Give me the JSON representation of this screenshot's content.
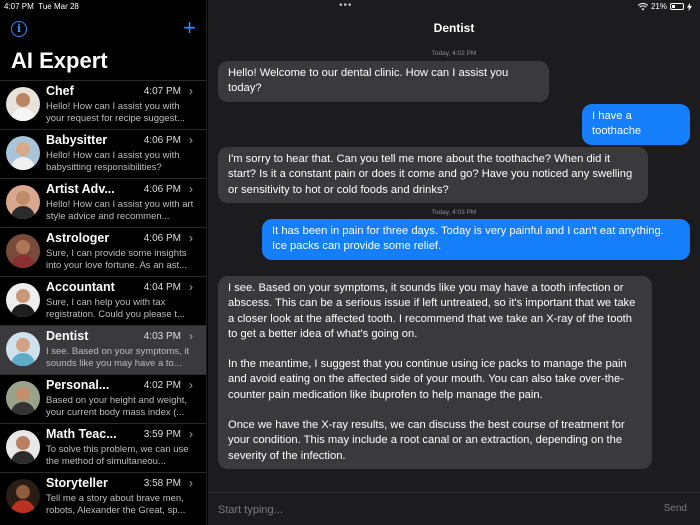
{
  "status_bar": {
    "time": "4:07 PM",
    "date": "Tue Mar 28",
    "battery_text": "21%",
    "battery_level": 21,
    "wifi_icon": "wifi-icon",
    "charging_icon": "bolt-icon"
  },
  "sidebar": {
    "title": "AI Expert",
    "info_icon": "info-icon",
    "add_icon": "plus-icon",
    "items": [
      {
        "name": "Chef",
        "time": "4:07 PM",
        "preview": "Hello! How can I assist you with your request for recipe suggest..."
      },
      {
        "name": "Babysitter",
        "time": "4:06 PM",
        "preview": "Hello! How can I assist you with babysitting responsibilities?"
      },
      {
        "name": "Artist Adv...",
        "time": "4:06 PM",
        "preview": "Hello! How can I assist you with art style advice and recommen..."
      },
      {
        "name": "Astrologer",
        "time": "4:06 PM",
        "preview": "Sure, I can provide some insights into your love fortune. As an ast..."
      },
      {
        "name": "Accountant",
        "time": "4:04 PM",
        "preview": "Sure, I can help you with tax registration. Could you please t..."
      },
      {
        "name": "Dentist",
        "time": "4:03 PM",
        "preview": "I see. Based on your symptoms, it sounds like you may have a to..."
      },
      {
        "name": "Personal...",
        "time": "4:02 PM",
        "preview": "Based on your height and weight, your current body mass index (..."
      },
      {
        "name": "Math Teac...",
        "time": "3:59 PM",
        "preview": "To solve this problem, we can use the method of simultaneou..."
      },
      {
        "name": "Storyteller",
        "time": "3:58 PM",
        "preview": "Tell me a story about brave men, robots, Alexander the Great, sp..."
      }
    ]
  },
  "chat": {
    "title": "Dentist",
    "timestamps": [
      "Today, 4:02 PM",
      "Today, 4:03 PM"
    ],
    "messages": [
      {
        "role": "ai",
        "paragraphs": [
          "Hello! Welcome to our dental clinic. How can I assist you today?"
        ]
      },
      {
        "role": "user",
        "paragraphs": [
          "I have a toothache"
        ]
      },
      {
        "role": "ai",
        "paragraphs": [
          "I'm sorry to hear that. Can you tell me more about the toothache? When did it start? Is it a constant pain or does it come and go? Have you noticed any swelling or sensitivity to hot or cold foods and drinks?"
        ]
      },
      {
        "role": "user",
        "paragraphs": [
          "It has been in pain for three days. Today is very painful and I can't eat anything. Ice packs can provide some relief."
        ]
      },
      {
        "role": "ai",
        "paragraphs": [
          "I see. Based on your symptoms, it sounds like you may have a tooth infection or abscess. This can be a serious issue if left untreated, so it's important that we take a closer look at the affected tooth. I recommend that we take an X-ray of the tooth to get a better idea of what's going on.",
          "In the meantime, I suggest that you continue using ice packs to manage the pain and avoid eating on the affected side of your mouth. You can also take over-the-counter pain medication like ibuprofen to help manage the pain.",
          "Once we have the X-ray results, we can discuss the best course of treatment for your condition. This may include a root canal or an extraction, depending on the severity of the infection."
        ]
      }
    ]
  },
  "composer": {
    "placeholder": "Start typing...",
    "send_label": "Send"
  },
  "colors": {
    "accent": "#147efb",
    "ai_bubble": "#3a3a3c",
    "background": "#1c1c1e"
  }
}
